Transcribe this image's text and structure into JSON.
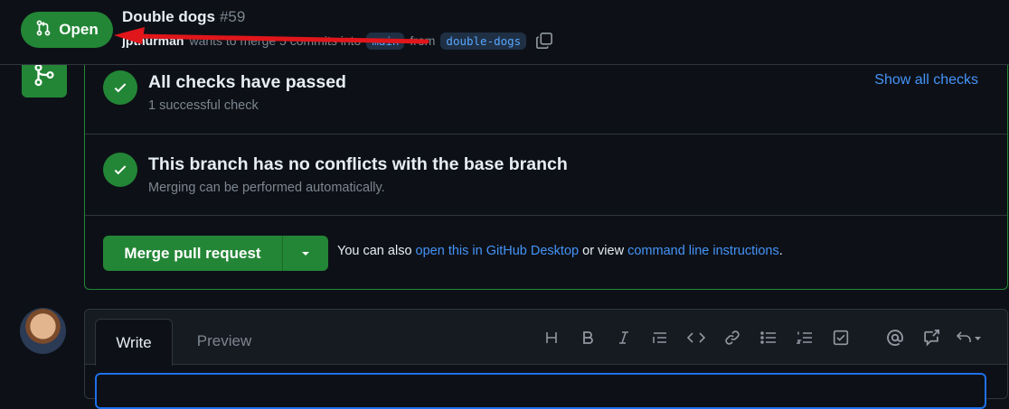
{
  "header": {
    "state_label": "Open",
    "title": "Double dogs",
    "number": "#59",
    "author": "jpthurman",
    "meta_text": "wants to merge 5 commits into",
    "base_branch": "main",
    "from_text": "from",
    "head_branch": "double-dogs"
  },
  "checks": [
    {
      "title": "All checks have passed",
      "subtitle": "1 successful check"
    },
    {
      "title": "This branch has no conflicts with the base branch",
      "subtitle": "Merging can be performed automatically."
    }
  ],
  "show_all_checks": "Show all checks",
  "merge": {
    "button_label": "Merge pull request",
    "note_prefix": "You can also",
    "link_desktop": "open this in GitHub Desktop",
    "note_middle": "or view",
    "link_cli": "command line instructions",
    "note_suffix": "."
  },
  "comment": {
    "tabs": [
      "Write",
      "Preview"
    ],
    "toolbar_icons": [
      "heading-icon",
      "bold-icon",
      "italic-icon",
      "quote-icon",
      "code-icon",
      "link-icon",
      "bulleted-list-icon",
      "numbered-list-icon",
      "task-list-icon",
      "mention-icon",
      "cross-reference-icon",
      "reply-icon"
    ]
  },
  "colors": {
    "accent_green": "#238636",
    "link_blue": "#4493f8",
    "annotation_red": "#e0161b",
    "background": "#0d1117"
  }
}
